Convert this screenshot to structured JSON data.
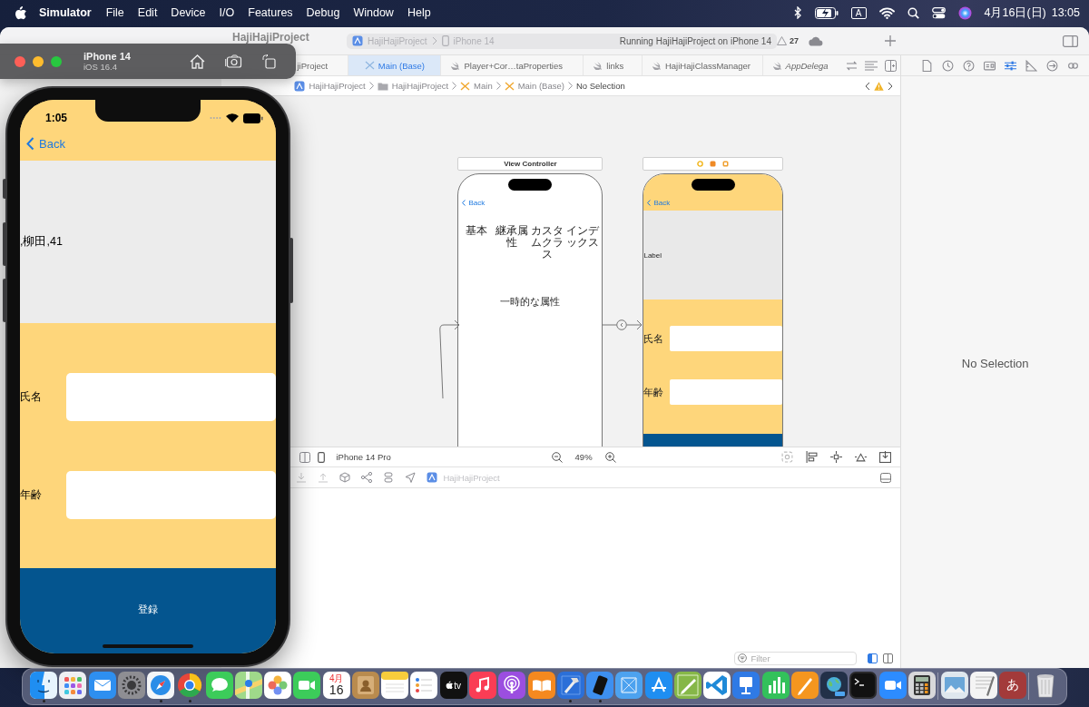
{
  "menu_bar": {
    "app": "Simulator",
    "menus": [
      "File",
      "Edit",
      "Device",
      "I/O",
      "Features",
      "Debug",
      "Window",
      "Help"
    ],
    "input_source": "A",
    "date": "4月16日(日)",
    "time": "13:05"
  },
  "xcode": {
    "project_title": "HajiHajiProject",
    "scheme": "HajiHajiProject",
    "destination": "iPhone 14",
    "activity": "Running HajiHajiProject on iPhone 14",
    "warnings": "27",
    "tabs": [
      {
        "label": "jiProject",
        "selected": false,
        "preview": false
      },
      {
        "label": "Main (Base)",
        "selected": true,
        "preview": false
      },
      {
        "label": "Player+Cor…taProperties",
        "selected": false,
        "preview": false
      },
      {
        "label": "links",
        "selected": false,
        "preview": false
      },
      {
        "label": "HajiHajiClassManager",
        "selected": false,
        "preview": false
      },
      {
        "label": "AppDelega",
        "selected": false,
        "preview": true
      }
    ],
    "breadcrumb": [
      {
        "kind": "project",
        "label": "HajiHajiProject"
      },
      {
        "kind": "folder",
        "label": "HajiHajiProject"
      },
      {
        "kind": "storyboard",
        "label": "Main"
      },
      {
        "kind": "storyboard",
        "label": "Main (Base)"
      },
      {
        "kind": "none",
        "label": "No Selection"
      }
    ],
    "scenes": [
      {
        "kind": "list",
        "title": "View Controller",
        "back": "Back",
        "segments": [
          "基本",
          "継承属性",
          "カスタムクラス",
          "インデックス"
        ],
        "label": "一時的な属性"
      },
      {
        "kind": "form",
        "back": "Back",
        "label": "Label",
        "fields": [
          {
            "label": "氏名"
          },
          {
            "label": "年齢"
          }
        ]
      }
    ],
    "canvas_bar": {
      "device": "iPhone 14 Pro",
      "zoom": "49%"
    },
    "debug_bar": {
      "target": "HajiHajiProject"
    },
    "filter": {
      "placeholder": "Filter"
    },
    "inspector": {
      "tabs": [
        {
          "kind": "file",
          "selected": false
        },
        {
          "kind": "history",
          "selected": false
        },
        {
          "kind": "help",
          "selected": false
        },
        {
          "kind": "identity",
          "selected": false
        },
        {
          "kind": "attributes",
          "selected": true
        },
        {
          "kind": "size",
          "selected": false
        },
        {
          "kind": "connections",
          "selected": false
        },
        {
          "kind": "bindings",
          "selected": false
        }
      ],
      "message": "No Selection"
    }
  },
  "simulator": {
    "device": "iPhone 14",
    "os": "iOS 16.4",
    "time": "1:05",
    "back": "Back",
    "result": ",柳田,41",
    "fields": [
      {
        "label": "氏名"
      },
      {
        "label": "年齢"
      }
    ],
    "button": "登録"
  },
  "dock": {
    "items": [
      {
        "kind": "split",
        "running": true
      },
      {
        "kind": "grid",
        "running": false
      },
      {
        "kind": "envelope",
        "running": false
      },
      {
        "kind": "gear",
        "running": false
      },
      {
        "kind": "compass",
        "running": true
      },
      {
        "kind": "ring",
        "running": true
      },
      {
        "kind": "bubble",
        "running": false
      },
      {
        "kind": "map",
        "running": false
      },
      {
        "kind": "flower",
        "running": false
      },
      {
        "kind": "camera",
        "running": false
      },
      {
        "kind": "calendar",
        "running": false,
        "month": "4月",
        "day": "16"
      },
      {
        "kind": "contacts",
        "running": false
      },
      {
        "kind": "notepad",
        "running": false
      },
      {
        "kind": "list",
        "running": false
      },
      {
        "kind": "tv",
        "running": false,
        "label": "tv"
      },
      {
        "kind": "note",
        "running": false
      },
      {
        "kind": "podcast",
        "running": false
      },
      {
        "kind": "book",
        "running": false
      },
      {
        "kind": "hammer",
        "running": true
      },
      {
        "kind": "device",
        "running": true
      },
      {
        "kind": "blueprint",
        "running": false
      },
      {
        "kind": "letter",
        "running": false
      },
      {
        "kind": "sketch",
        "running": false
      },
      {
        "kind": "code",
        "running": false
      },
      {
        "kind": "podium",
        "running": false
      },
      {
        "kind": "bars",
        "running": false
      },
      {
        "kind": "pen",
        "running": false
      },
      {
        "kind": "globe",
        "running": false
      },
      {
        "kind": "terminal",
        "running": false
      },
      {
        "kind": "video",
        "running": false
      },
      {
        "kind": "calculator",
        "running": false
      },
      {
        "kind": "divider"
      },
      {
        "kind": "photo",
        "running": false
      },
      {
        "kind": "document",
        "running": false
      },
      {
        "kind": "kana",
        "running": false,
        "label": "あ"
      },
      {
        "kind": "divider"
      },
      {
        "kind": "trash",
        "running": false
      }
    ]
  }
}
